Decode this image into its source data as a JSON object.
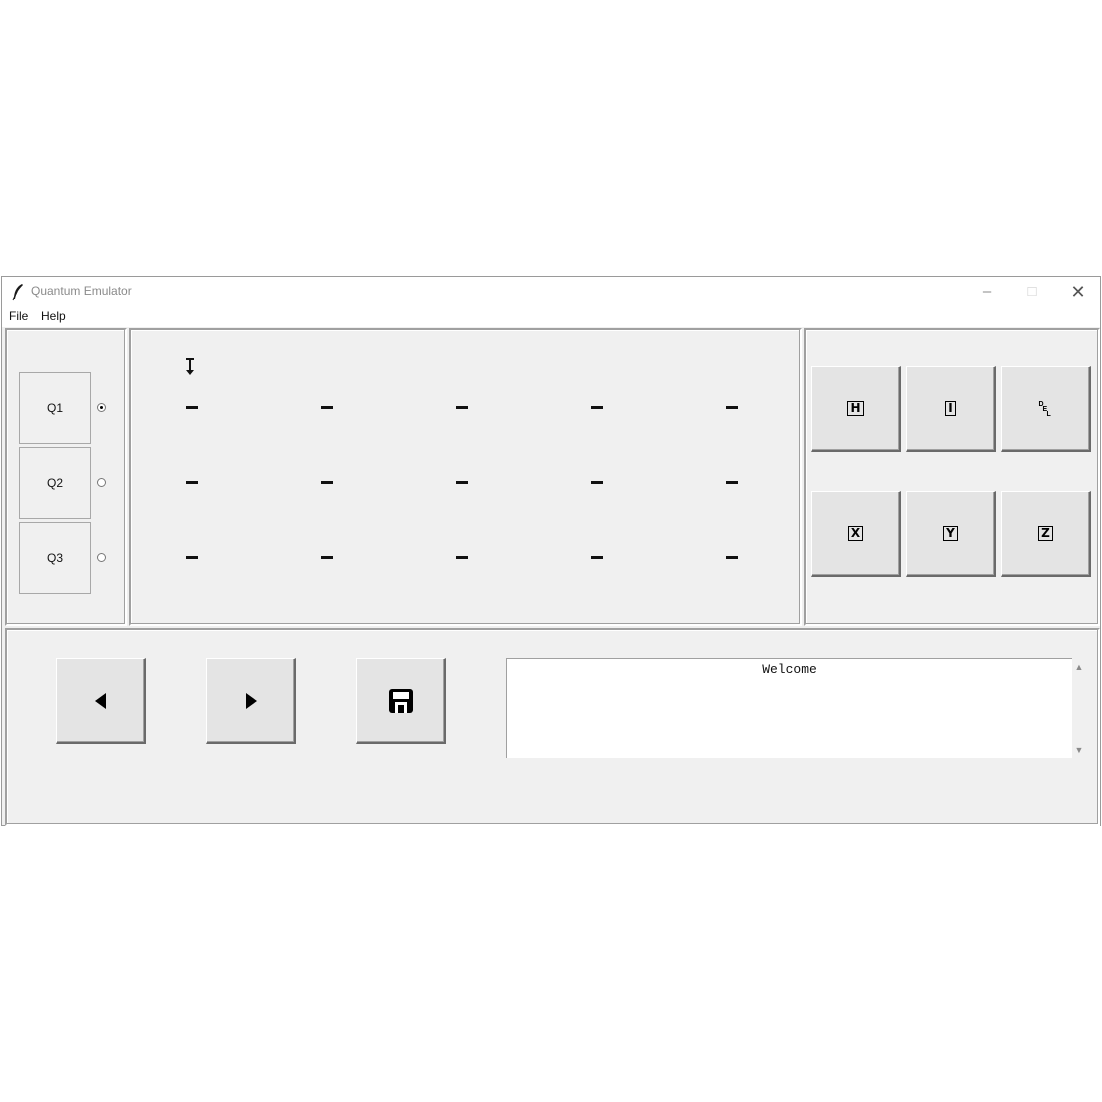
{
  "window": {
    "title": "Quantum Emulator",
    "controls": {
      "minimize": "–",
      "maximize": "□",
      "close": "✕"
    }
  },
  "menu": {
    "file": "File",
    "help": "Help"
  },
  "qubits": [
    {
      "label": "Q1",
      "selected": true
    },
    {
      "label": "Q2",
      "selected": false
    },
    {
      "label": "Q3",
      "selected": false
    }
  ],
  "circuit": {
    "rows": 3,
    "steps": 5,
    "cursor_step": 1,
    "cell_symbol": "—"
  },
  "gates": [
    {
      "id": "H",
      "label": "H"
    },
    {
      "id": "I",
      "label": "I"
    },
    {
      "id": "DEL",
      "label": "DEL"
    },
    {
      "id": "X",
      "label": "X"
    },
    {
      "id": "Y",
      "label": "Y"
    },
    {
      "id": "Z",
      "label": "Z"
    }
  ],
  "toolbar": {
    "back_icon": "triangle-left-icon",
    "forward_icon": "triangle-right-icon",
    "save_icon": "floppy-disk-icon"
  },
  "output": {
    "text": "Welcome"
  }
}
